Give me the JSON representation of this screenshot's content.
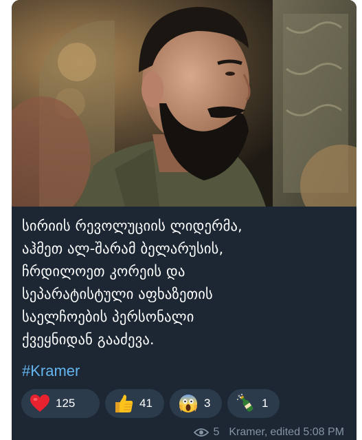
{
  "post": {
    "text_lines": [
      "სირიის რევოლუციის ლიდერმა,",
      "აჰმეთ ალ-შარამ ბელარუსის,",
      "ჩრდილოეთ კორეის და",
      "სეპარატისტული აფხაზეთის",
      "საელჩოების პერსონალი",
      "ქვეყნიდან გააძევა."
    ],
    "hashtag": "#Kramer",
    "photo_icon": "photo-of-bearded-man"
  },
  "reactions": [
    {
      "icon": "red-heart-icon",
      "count": "125"
    },
    {
      "icon": "thumbs-up-icon",
      "count": "41"
    },
    {
      "icon": "screaming-face-icon",
      "count": "3"
    },
    {
      "icon": "champagne-bottle-icon",
      "count": "1"
    }
  ],
  "footer": {
    "views": "5",
    "author": "Kramer,",
    "edited": "edited 5:08 PM",
    "icon": "eye-icon"
  },
  "colors": {
    "bubble_bg": "#1c2733",
    "reaction_bg": "#2b3b4c",
    "hashtag": "#64b5ef",
    "meta": "#8594a3",
    "text": "#ffffff"
  }
}
